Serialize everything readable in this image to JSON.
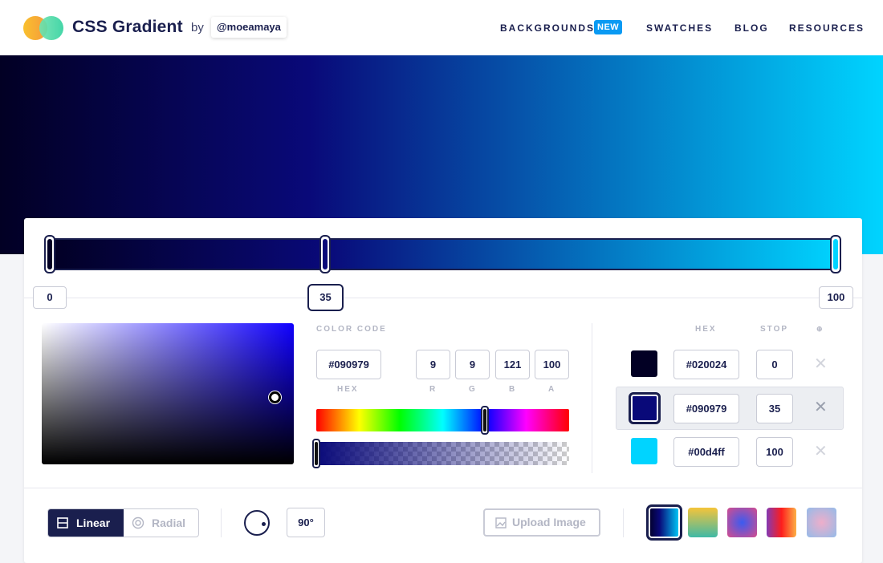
{
  "header": {
    "brand": "CSS Gradient",
    "by": "by",
    "handle": "@moeamaya",
    "nav": [
      {
        "label": "BACKGROUNDS",
        "badge": "NEW"
      },
      {
        "label": "SWATCHES"
      },
      {
        "label": "BLOG"
      },
      {
        "label": "RESOURCES"
      }
    ]
  },
  "gradient": {
    "css": "linear-gradient(90deg, #020024 0%, #090979 35%, #00d4ff 100%)",
    "stops": [
      {
        "color": "#020024",
        "position": "0"
      },
      {
        "color": "#090979",
        "position": "35"
      },
      {
        "color": "#00d4ff",
        "position": "100"
      }
    ],
    "selected_stop": 1
  },
  "picker": {
    "section_label": "COLOR CODE",
    "hex": "#090979",
    "r": "9",
    "g": "9",
    "b": "121",
    "a": "100",
    "labels": {
      "hex": "HEX",
      "r": "R",
      "g": "G",
      "b": "B",
      "a": "A"
    },
    "hue_fraction": 0.667,
    "alpha_fraction": 1.0
  },
  "stops_table": {
    "col_hex": "HEX",
    "col_stop": "STOP",
    "col_remove": "⊕",
    "rows": [
      {
        "hex": "#020024",
        "stop": "0",
        "color": "#020024",
        "remove": "✕"
      },
      {
        "hex": "#090979",
        "stop": "35",
        "color": "#090979",
        "remove": "✕"
      },
      {
        "hex": "#00d4ff",
        "stop": "100",
        "color": "#00d4ff",
        "remove": "✕"
      }
    ]
  },
  "toolbar": {
    "linear_label": "Linear",
    "radial_label": "Radial",
    "angle": "90°",
    "upload_label": "Upload Image",
    "presets": [
      {
        "name": "current",
        "css": "linear-gradient(90deg, #020024 0%, #090979 35%, #00d4ff 100%)"
      },
      {
        "name": "preset-2",
        "css": "linear-gradient(180deg, #f5c43a 0%, #3fb9a6 100%)"
      },
      {
        "name": "preset-3",
        "css": "radial-gradient(circle, #3b5bf0 0%, #d64c8c 100%)"
      },
      {
        "name": "preset-4",
        "css": "linear-gradient(90deg, #833ab4 0%, #fd1d1d 50%, #fcb045 100%)"
      },
      {
        "name": "preset-5",
        "css": "radial-gradient(circle, #eeaeca 0%, #94bbe9 100%)"
      }
    ]
  },
  "icons": {
    "linear": "linear-gradient-icon",
    "radial": "radial-gradient-icon",
    "angle": "angle-dial-icon",
    "upload": "image-icon",
    "remove": "close-icon",
    "add": "add-icon"
  }
}
